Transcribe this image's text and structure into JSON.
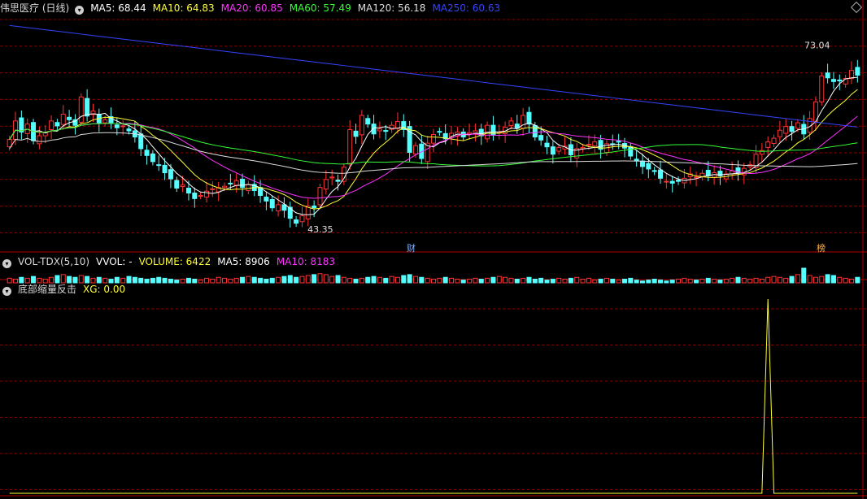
{
  "main_header": {
    "title": "伟思医疗 (日线)",
    "indicators": [
      {
        "text": "MA5: 68.44",
        "color": "#ffffff"
      },
      {
        "text": "MA10: 64.83",
        "color": "#ffff33"
      },
      {
        "text": "MA20: 60.85",
        "color": "#ff33ff"
      },
      {
        "text": "MA60: 57.49",
        "color": "#33ff33"
      },
      {
        "text": "MA120: 56.18",
        "color": "#dddddd"
      },
      {
        "text": "MA250: 60.63",
        "color": "#3344ff"
      }
    ]
  },
  "vol_header": {
    "title": "VOL-TDX(5,10)",
    "indicators": [
      {
        "text": "VVOL: -",
        "color": "#ffffff"
      },
      {
        "text": "VOLUME: 6422",
        "color": "#ffff33"
      },
      {
        "text": "MA5: 8906",
        "color": "#ffffff"
      },
      {
        "text": "MA10: 8183",
        "color": "#ff33ff"
      }
    ]
  },
  "xg_header": {
    "title": "底部缩量反击",
    "indicators": [
      {
        "text": "XG: 0.00",
        "color": "#ffff33"
      }
    ]
  },
  "chart_data": {
    "type": "candlestick",
    "title": "伟思医疗 (日线)",
    "price_range": [
      40,
      78
    ],
    "max_label": "73.04",
    "min_label": "43.35",
    "markers": [
      "财",
      "榜"
    ],
    "colors": {
      "up": "#ff3232",
      "down": "#54ffff",
      "ma5": "#ffffff",
      "ma10": "#ffff33",
      "ma20": "#ff33ff",
      "ma60": "#33ff33",
      "ma120": "#dddddd",
      "ma250": "#3344ff",
      "grid": "#8b0000"
    },
    "closes": [
      58.0,
      61.0,
      59.2,
      60.5,
      57.8,
      58.6,
      59.1,
      61.0,
      60.2,
      62.1,
      61.2,
      60.3,
      64.9,
      61.8,
      62.6,
      60.7,
      61.2,
      60.6,
      59.9,
      60.2,
      59.4,
      58.4,
      56.5,
      55.4,
      54.4,
      53.8,
      52.6,
      51.6,
      50.1,
      50.6,
      49.3,
      48.4,
      48.9,
      49.6,
      50.0,
      50.2,
      50.4,
      50.8,
      51.3,
      50.2,
      50.7,
      49.7,
      48.9,
      48.0,
      46.9,
      47.4,
      46.5,
      45.2,
      44.4,
      45.6,
      47.2,
      46.9,
      50.2,
      51.5,
      51.9,
      51.2,
      53.5,
      59.6,
      58.5,
      61.9,
      60.5,
      58.9,
      59.7,
      59.4,
      60.3,
      60.9,
      59.6,
      55.9,
      57.0,
      54.9,
      57.4,
      58.8,
      59.2,
      58.1,
      59.0,
      59.2,
      58.4,
      59.1,
      59.4,
      58.6,
      60.3,
      58.7,
      59.2,
      60.0,
      61.0,
      59.8,
      61.9,
      60.5,
      58.4,
      57.9,
      56.8,
      55.6,
      56.7,
      56.9,
      55.5,
      56.5,
      56.7,
      57.2,
      57.6,
      56.4,
      57.3,
      57.2,
      57.6,
      56.6,
      55.3,
      54.5,
      53.6,
      53.2,
      52.8,
      51.7,
      51.2,
      50.9,
      51.2,
      51.7,
      52.4,
      51.9,
      52.5,
      52.1,
      52.6,
      52.1,
      52.4,
      52.9,
      52.5,
      53.3,
      53.9,
      55.6,
      56.2,
      57.6,
      58.2,
      59.5,
      60.1,
      59.3,
      60.7,
      58.9,
      61.4,
      64.1,
      68.3,
      68.0,
      67.4,
      67.5,
      67.9,
      69.2,
      68.44
    ],
    "volume": {
      "values": [
        5,
        4,
        6,
        5,
        7,
        5,
        4,
        6,
        8,
        9,
        7,
        6,
        8,
        7,
        5,
        6,
        5,
        4,
        6,
        5,
        7,
        6,
        5,
        4,
        5,
        6,
        5,
        4,
        3,
        4,
        5,
        4,
        3,
        5,
        4,
        6,
        5,
        4,
        5,
        6,
        7,
        6,
        5,
        4,
        5,
        6,
        7,
        8,
        6,
        7,
        8,
        9,
        10,
        9,
        7,
        8,
        6,
        5,
        4,
        5,
        6,
        7,
        6,
        5,
        7,
        6,
        8,
        9,
        7,
        6,
        5,
        4,
        5,
        6,
        5,
        4,
        3,
        4,
        5,
        4,
        5,
        6,
        7,
        6,
        5,
        4,
        5,
        6,
        4,
        5,
        3,
        4,
        5,
        4,
        5,
        6,
        4,
        5,
        3,
        4,
        5,
        4,
        3,
        4,
        5,
        3,
        2,
        3,
        4,
        3,
        2,
        3,
        4,
        5,
        4,
        3,
        4,
        5,
        4,
        3,
        4,
        5,
        6,
        5,
        4,
        5,
        4,
        6,
        7,
        6,
        5,
        7,
        9,
        16,
        8,
        6,
        7,
        9,
        8,
        6
      ],
      "ma5": 8906,
      "ma10": 8183,
      "volume_last": 6422
    },
    "xg": {
      "values_index_with_signal": 127,
      "last": 0.0
    }
  }
}
